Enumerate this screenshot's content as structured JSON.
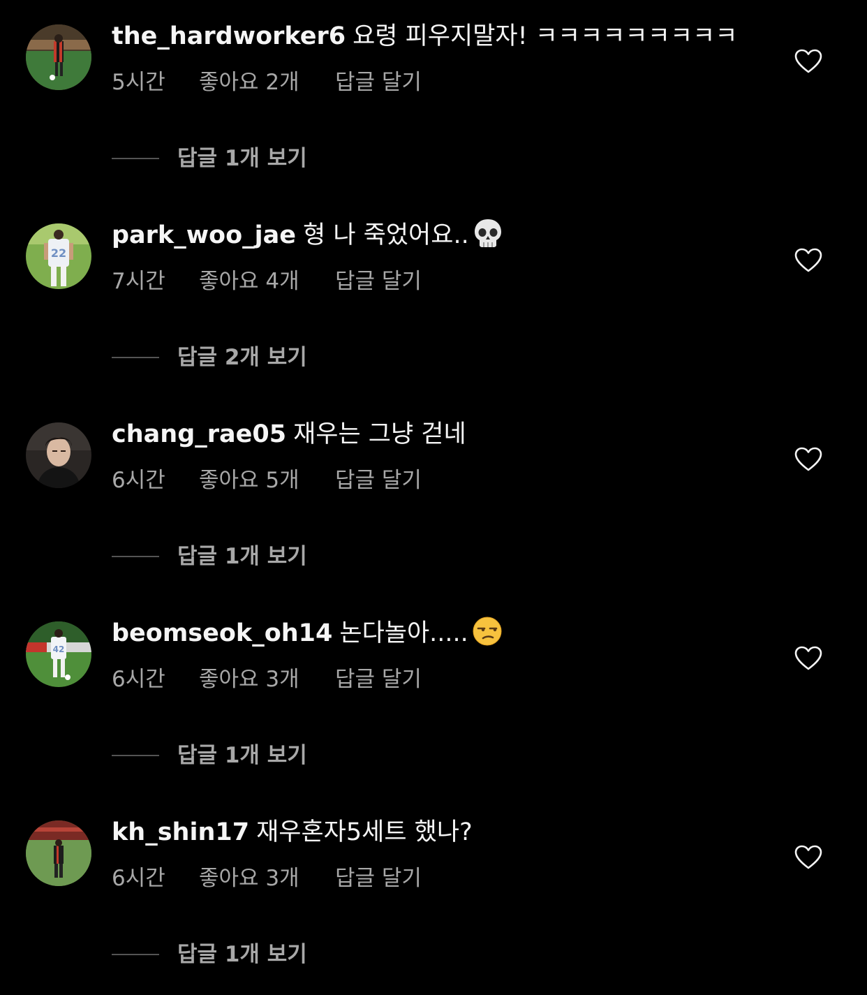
{
  "comments": [
    {
      "username": "the_hardworker6",
      "text": "요령 피우지말자! ㅋㅋㅋㅋㅋㅋㅋㅋㅋ",
      "time": "5시간",
      "likes": "좋아요 2개",
      "reply_action": "답글 달기",
      "view_replies": "답글 1개 보기",
      "avatar": "avatar-soccer-player-red-black",
      "emoji": ""
    },
    {
      "username": "park_woo_jae",
      "text": "형 나 죽었어요..",
      "time": "7시간",
      "likes": "좋아요 4개",
      "reply_action": "답글 달기",
      "view_replies": "답글 2개 보기",
      "avatar": "avatar-soccer-player-white-22",
      "emoji": "skull-emoji"
    },
    {
      "username": "chang_rae05",
      "text": "재우는 그냥 걷네",
      "time": "6시간",
      "likes": "좋아요 5개",
      "reply_action": "답글 달기",
      "view_replies": "답글 1개 보기",
      "avatar": "avatar-selfie-portrait",
      "emoji": ""
    },
    {
      "username": "beomseok_oh14",
      "text": "논다놀아.....",
      "time": "6시간",
      "likes": "좋아요 3개",
      "reply_action": "답글 달기",
      "view_replies": "답글 1개 보기",
      "avatar": "avatar-soccer-player-white-42",
      "emoji": "unamused-face-emoji"
    },
    {
      "username": "kh_shin17",
      "text": "재우혼자5세트 했나?",
      "time": "6시간",
      "likes": "좋아요 3개",
      "reply_action": "답글 달기",
      "view_replies": "답글 1개 보기",
      "avatar": "avatar-soccer-player-red-stadium",
      "emoji": ""
    }
  ],
  "colors": {
    "background": "#000000",
    "primary_text": "#f5f5f5",
    "secondary_text": "#a8a8a8",
    "divider_dash": "#545454"
  }
}
